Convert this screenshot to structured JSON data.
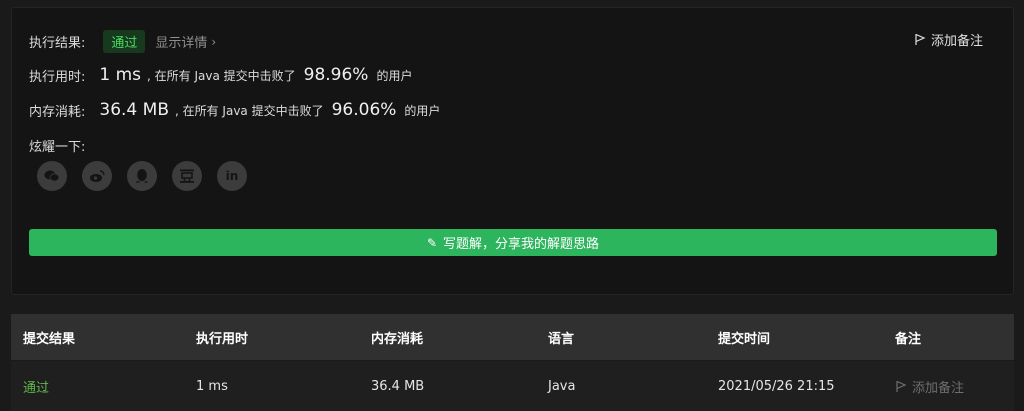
{
  "result": {
    "label": "执行结果:",
    "status": "通过",
    "details_link": "显示详情",
    "add_note": "添加备注"
  },
  "runtime": {
    "label": "执行用时:",
    "value": "1 ms",
    "desc": ", 在所有 Java 提交中击败了",
    "percent": "98.96%",
    "suffix": "的用户"
  },
  "memory": {
    "label": "内存消耗:",
    "value": "36.4 MB",
    "desc": ", 在所有 Java 提交中击败了",
    "percent": "96.06%",
    "suffix": "的用户"
  },
  "share": {
    "label": "炫耀一下:",
    "icons": [
      "wechat-icon",
      "weibo-icon",
      "qq-icon",
      "douban-icon",
      "linkedin-icon"
    ]
  },
  "solution_button": "写题解，分享我的解题思路",
  "table": {
    "headers": [
      "提交结果",
      "执行用时",
      "内存消耗",
      "语言",
      "提交时间",
      "备注"
    ],
    "rows": [
      {
        "status": "通过",
        "runtime": "1 ms",
        "memory": "36.4 MB",
        "language": "Java",
        "time": "2021/05/26 21:15",
        "note": "添加备注"
      }
    ]
  },
  "colors": {
    "accent_green": "#2cb55d",
    "pass_green": "#5fb84a",
    "badge_bg": "#173a1f"
  }
}
